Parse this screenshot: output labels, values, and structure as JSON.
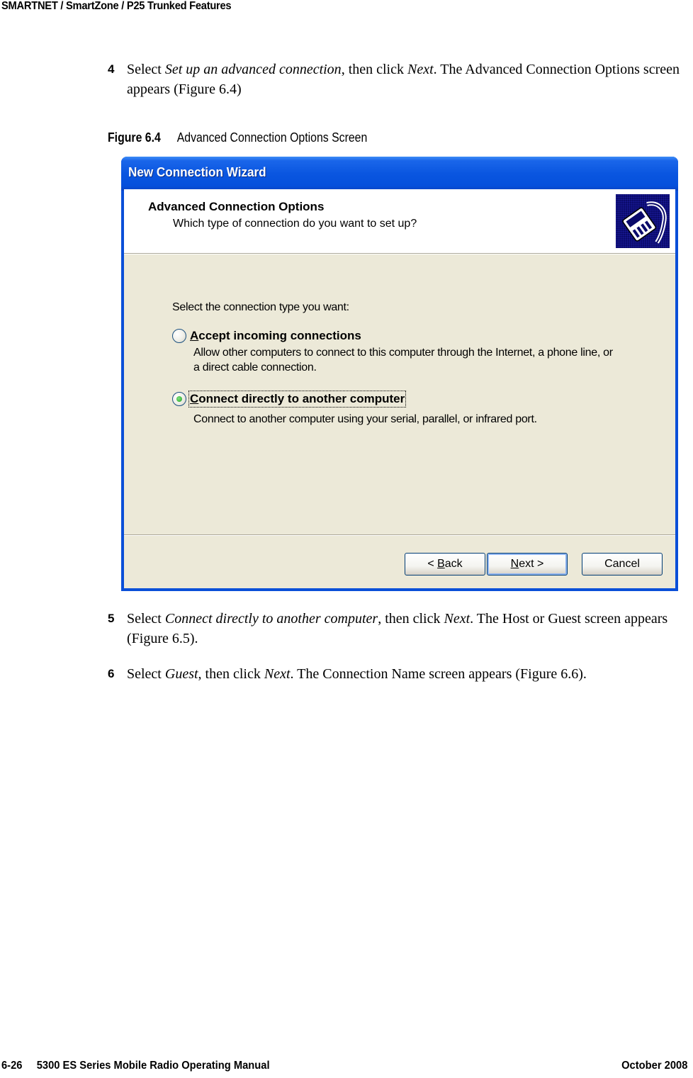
{
  "running_header": "SMARTNET / SmartZone / P25 Trunked Features",
  "steps": [
    {
      "number": "4",
      "parts": {
        "a": "Select ",
        "b": "Set up an advanced connection",
        "c": ", then click ",
        "d": "Next",
        "e": ". The Advanced Connection Options screen appears (Figure 6.4)"
      }
    },
    {
      "number": "5",
      "parts": {
        "a": "Select ",
        "b": "Connect directly to another computer",
        "c": ", then click ",
        "d": "Next",
        "e": ". The Host or Guest screen appears (Figure 6.5)."
      }
    },
    {
      "number": "6",
      "parts": {
        "a": "Select ",
        "b": "Guest",
        "c": ", then click ",
        "d": "Next",
        "e": ". The Connection Name screen appears (Figure 6.6)."
      }
    }
  ],
  "figure": {
    "label": "Figure 6.4",
    "caption": "Advanced Connection Options Screen"
  },
  "wizard": {
    "window_title": "New Connection Wizard",
    "heading": "Advanced Connection Options",
    "subheading": "Which type of connection do you want to set up?",
    "banner_icon": "network-cable-icon",
    "prompt": "Select the connection type you want:",
    "options": [
      {
        "mnemonic": "A",
        "label_rest": "ccept incoming connections",
        "description": "Allow other computers to connect to this computer through the Internet, a phone line, or a direct cable connection.",
        "selected": false
      },
      {
        "mnemonic": "C",
        "label_rest": "onnect directly to another computer",
        "description": "Connect to another computer using your serial, parallel, or infrared port.",
        "selected": true
      }
    ],
    "buttons": {
      "back_prefix": "< ",
      "back_mnemonic": "B",
      "back_rest": "ack",
      "next_mnemonic": "N",
      "next_rest": "ext >",
      "cancel": "Cancel"
    },
    "colors": {
      "titlebar": "#0550dc",
      "client_bg": "#ece9d8",
      "banner_bg": "#ffffff",
      "button_border": "#003c74"
    }
  },
  "page_footer": {
    "page_number": "6-26",
    "manual_title": "5300 ES Series Mobile Radio Operating Manual",
    "date": "October 2008"
  }
}
